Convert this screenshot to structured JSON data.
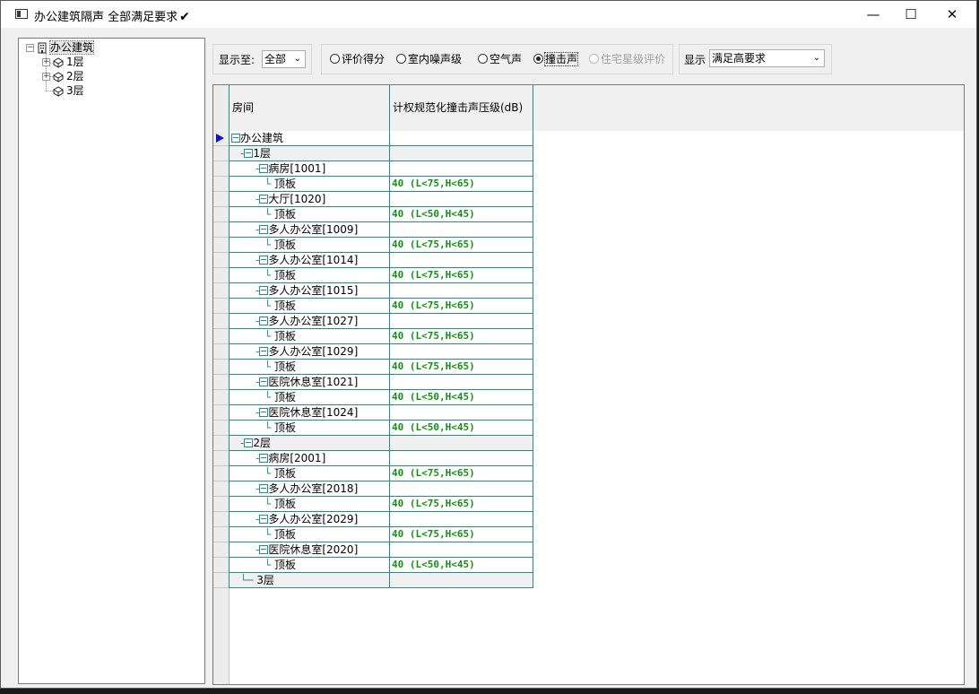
{
  "window": {
    "title": "办公建筑隔声  全部满足要求",
    "check_mark": "✔",
    "controls": {
      "minimize": "—",
      "maximize": "☐",
      "close": "✕"
    }
  },
  "tree": {
    "root": "办公建筑",
    "children": [
      "1层",
      "2层",
      "3层"
    ]
  },
  "toolbar": {
    "show_to_label": "显示至:",
    "show_to_value": "全部",
    "radios": [
      {
        "label": "评价得分",
        "checked": false,
        "enabled": true
      },
      {
        "label": "室内噪声级",
        "checked": false,
        "enabled": true
      },
      {
        "label": "空气声",
        "checked": false,
        "enabled": true
      },
      {
        "label": "撞击声",
        "checked": true,
        "enabled": true
      },
      {
        "label": "住宅星级评价",
        "checked": false,
        "enabled": false
      }
    ],
    "display_label": "显示",
    "display_value": "满足高要求"
  },
  "grid": {
    "headers": [
      "房间",
      "计权规范化撞击声压级(dB)"
    ],
    "rows": [
      {
        "level": 0,
        "kind": "node",
        "name": "办公建筑",
        "value": "",
        "current": true
      },
      {
        "level": 1,
        "kind": "floor",
        "name": "1层",
        "value": ""
      },
      {
        "level": 2,
        "kind": "room",
        "name": "病房[1001]",
        "value": ""
      },
      {
        "level": 3,
        "kind": "leaf",
        "name": "顶板",
        "value": "40 (L<75,H<65)"
      },
      {
        "level": 2,
        "kind": "room",
        "name": "大厅[1020]",
        "value": ""
      },
      {
        "level": 3,
        "kind": "leaf",
        "name": "顶板",
        "value": "40 (L<50,H<45)"
      },
      {
        "level": 2,
        "kind": "room",
        "name": "多人办公室[1009]",
        "value": ""
      },
      {
        "level": 3,
        "kind": "leaf",
        "name": "顶板",
        "value": "40 (L<75,H<65)"
      },
      {
        "level": 2,
        "kind": "room",
        "name": "多人办公室[1014]",
        "value": ""
      },
      {
        "level": 3,
        "kind": "leaf",
        "name": "顶板",
        "value": "40 (L<75,H<65)"
      },
      {
        "level": 2,
        "kind": "room",
        "name": "多人办公室[1015]",
        "value": ""
      },
      {
        "level": 3,
        "kind": "leaf",
        "name": "顶板",
        "value": "40 (L<75,H<65)"
      },
      {
        "level": 2,
        "kind": "room",
        "name": "多人办公室[1027]",
        "value": ""
      },
      {
        "level": 3,
        "kind": "leaf",
        "name": "顶板",
        "value": "40 (L<75,H<65)"
      },
      {
        "level": 2,
        "kind": "room",
        "name": "多人办公室[1029]",
        "value": ""
      },
      {
        "level": 3,
        "kind": "leaf",
        "name": "顶板",
        "value": "40 (L<75,H<65)"
      },
      {
        "level": 2,
        "kind": "room",
        "name": "医院休息室[1021]",
        "value": ""
      },
      {
        "level": 3,
        "kind": "leaf",
        "name": "顶板",
        "value": "40 (L<50,H<45)"
      },
      {
        "level": 2,
        "kind": "room",
        "name": "医院休息室[1024]",
        "value": ""
      },
      {
        "level": 3,
        "kind": "leaf",
        "name": "顶板",
        "value": "40 (L<50,H<45)"
      },
      {
        "level": 1,
        "kind": "floor",
        "name": "2层",
        "value": ""
      },
      {
        "level": 2,
        "kind": "room",
        "name": "病房[2001]",
        "value": ""
      },
      {
        "level": 3,
        "kind": "leaf",
        "name": "顶板",
        "value": "40 (L<75,H<65)"
      },
      {
        "level": 2,
        "kind": "room",
        "name": "多人办公室[2018]",
        "value": ""
      },
      {
        "level": 3,
        "kind": "leaf",
        "name": "顶板",
        "value": "40 (L<75,H<65)"
      },
      {
        "level": 2,
        "kind": "room",
        "name": "多人办公室[2029]",
        "value": ""
      },
      {
        "level": 3,
        "kind": "leaf",
        "name": "顶板",
        "value": "40 (L<75,H<65)"
      },
      {
        "level": 2,
        "kind": "room",
        "name": "医院休息室[2020]",
        "value": ""
      },
      {
        "level": 3,
        "kind": "leaf",
        "name": "顶板",
        "value": "40 (L<50,H<45)"
      },
      {
        "level": 1,
        "kind": "floor-empty",
        "name": "3层",
        "value": ""
      }
    ]
  }
}
